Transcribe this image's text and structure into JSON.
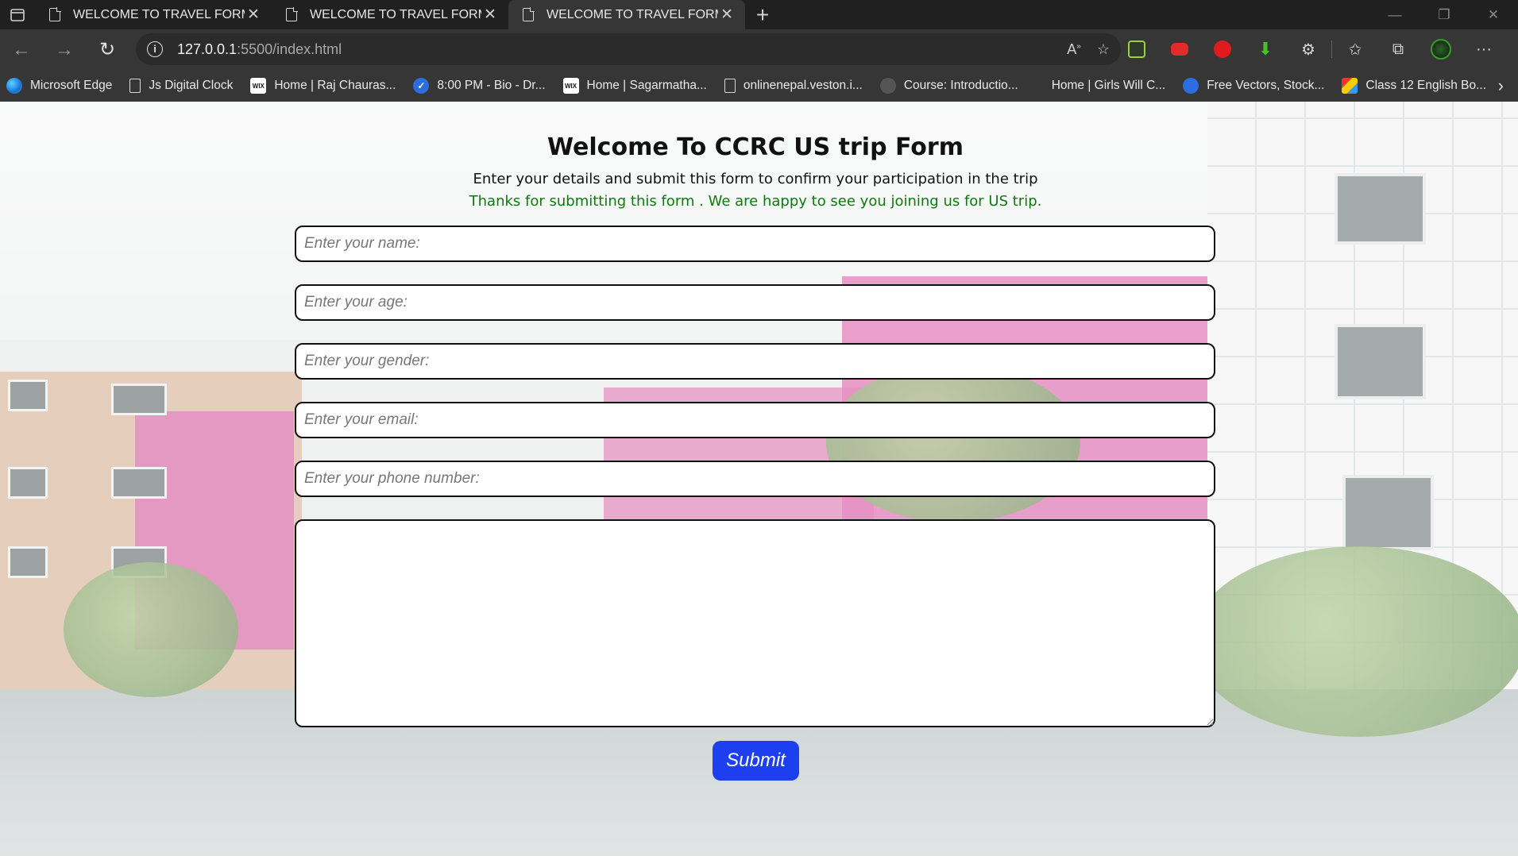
{
  "browser": {
    "tabs": [
      {
        "title": "WELCOME TO TRAVEL FORM",
        "active": false
      },
      {
        "title": "WELCOME TO TRAVEL FORM",
        "active": false
      },
      {
        "title": "WELCOME TO TRAVEL FORM",
        "active": true
      }
    ],
    "url": {
      "host": "127.0.0.1",
      "rest": ":5500/index.html"
    },
    "bookmarks": [
      {
        "label": "Microsoft Edge",
        "icon": "edge-icon"
      },
      {
        "label": "Js Digital Clock",
        "icon": "page-icon"
      },
      {
        "label": "Home | Raj Chauras...",
        "icon": "wix-icon"
      },
      {
        "label": "8:00 PM - Bio - Dr...",
        "icon": "check-icon"
      },
      {
        "label": "Home | Sagarmatha...",
        "icon": "wix-icon"
      },
      {
        "label": "onlinenepal.veston.i...",
        "icon": "page-icon"
      },
      {
        "label": "Course: Introductio...",
        "icon": "course-icon"
      },
      {
        "label": "Home | Girls Will C...",
        "icon": "blank-icon"
      },
      {
        "label": "Free Vectors, Stock...",
        "icon": "globe-icon"
      },
      {
        "label": "Class 12 English Bo...",
        "icon": "class-icon"
      }
    ],
    "extension_colors": [
      "#2f3a2f",
      "#e32b2b",
      "#e11b1b",
      "#4bbf2a",
      "#cccccc"
    ]
  },
  "form": {
    "title": "Welcome To CCRC US trip Form",
    "subtitle": "Enter your details and submit this form to confirm your participation in the trip",
    "thanks": "Thanks for submitting this form . We are happy to see you joining us for US trip.",
    "fields": {
      "name": "Enter your name:",
      "age": "Enter your age:",
      "gender": "Enter your gender:",
      "email": "Enter your email:",
      "phone": "Enter your phone number:"
    },
    "submit_label": "Submit",
    "colors": {
      "submit_bg": "#1d3fef",
      "thanks_text": "#0d7a0d"
    }
  }
}
